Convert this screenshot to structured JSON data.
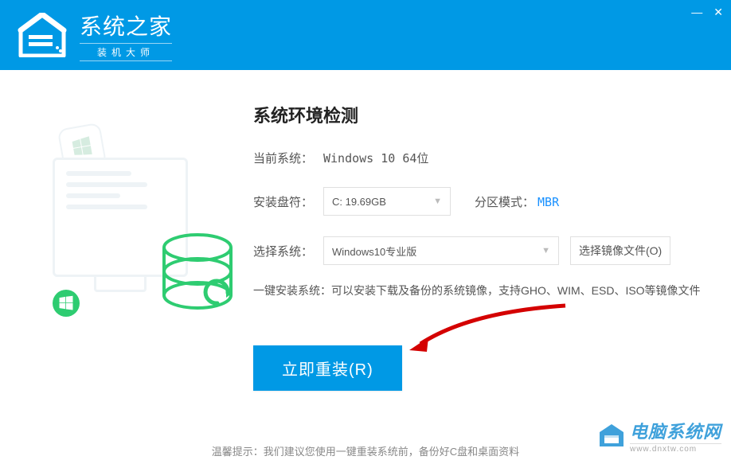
{
  "header": {
    "title": "系统之家",
    "subtitle": "装机大师"
  },
  "heading": "系统环境检测",
  "current_os": {
    "label": "当前系统：",
    "value": "Windows 10 64位"
  },
  "install_drive": {
    "label": "安装盘符：",
    "value": "C: 19.69GB"
  },
  "partition_mode": {
    "label": "分区模式：",
    "value": "MBR"
  },
  "select_system": {
    "label": "选择系统：",
    "value": "Windows10专业版",
    "image_button": "选择镜像文件(O)"
  },
  "help_text": "一键安装系统：可以安装下载及备份的系统镜像，支持GHO、WIM、ESD、ISO等镜像文件",
  "primary_button": "立即重装(R)",
  "footer_tip": "温馨提示：我们建议您使用一键重装系统前，备份好C盘和桌面资料",
  "bottom_logo": {
    "cn": "电脑系统网",
    "en": "www.dnxtw.com"
  }
}
